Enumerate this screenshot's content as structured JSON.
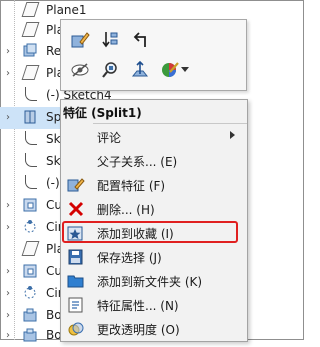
{
  "tree": {
    "rows": [
      {
        "label": "Plane1",
        "expander": ""
      },
      {
        "label": "Pla",
        "expander": ""
      },
      {
        "label": "Re",
        "expander": "›"
      },
      {
        "label": "Pla",
        "expander": "›"
      },
      {
        "label": "(-) Sketch4",
        "expander": ""
      },
      {
        "label": "Sp",
        "expander": "›"
      },
      {
        "label": "Sk",
        "expander": ""
      },
      {
        "label": "Sk",
        "expander": ""
      },
      {
        "label": "(-)",
        "expander": ""
      },
      {
        "label": "Cu",
        "expander": "›"
      },
      {
        "label": "Cir",
        "expander": "›"
      },
      {
        "label": "Pla",
        "expander": ""
      },
      {
        "label": "Cu",
        "expander": "›"
      },
      {
        "label": "Cir",
        "expander": "›"
      },
      {
        "label": "Bo",
        "expander": "›"
      },
      {
        "label": "Bo",
        "expander": "›"
      }
    ]
  },
  "context_toolbar": {
    "buttons": [
      "edit-feature",
      "sort-down",
      "rollback",
      "hide",
      "zoom-to-selection",
      "normal-to",
      "appearance"
    ]
  },
  "context_menu": {
    "title": "特征 (Split1)",
    "items": [
      {
        "label": "评论",
        "has_submenu": true,
        "icon": ""
      },
      {
        "label": "父子关系... (E)",
        "icon": ""
      },
      {
        "label": "配置特征 (F)",
        "icon": "configure-feature"
      },
      {
        "label": "删除... (H)",
        "icon": "delete"
      },
      {
        "label": "添加到收藏 (I)",
        "icon": "add-to-favorites",
        "highlighted": true
      },
      {
        "label": "保存选择 (J)",
        "icon": "save-selection"
      },
      {
        "label": "添加到新文件夹 (K)",
        "icon": "add-to-new-folder"
      },
      {
        "label": "特征属性... (N)",
        "icon": "feature-properties"
      },
      {
        "label": "更改透明度 (O)",
        "icon": "change-transparency"
      }
    ]
  },
  "colors": {
    "highlight_border": "#e02020",
    "delete_red": "#d40000"
  }
}
